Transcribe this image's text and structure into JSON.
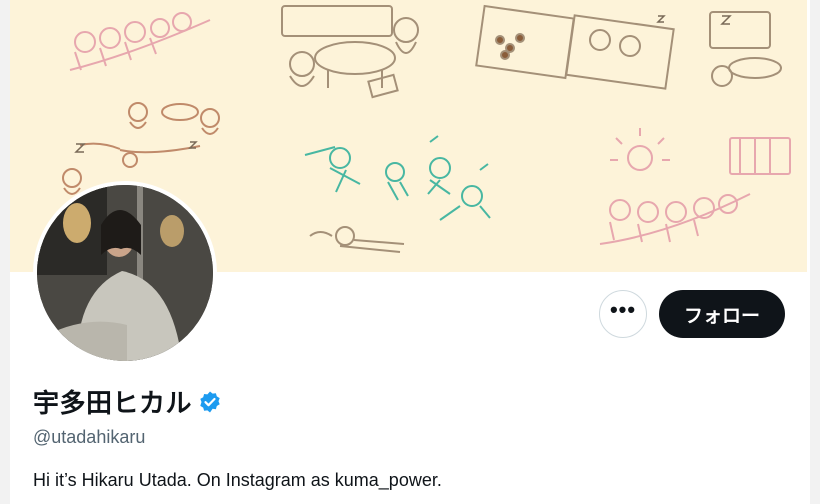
{
  "profile": {
    "display_name": "宇多田ヒカル",
    "handle": "@utadahikaru",
    "bio": "Hi it’s Hikaru Utada. On Instagram as kuma_power.",
    "verified": true
  },
  "actions": {
    "more_label": "•••",
    "follow_label": "フォロー"
  },
  "colors": {
    "banner_background": "#fdf3d9",
    "sketch_brown": "#b9a58b",
    "sketch_pink": "#e7a7ae",
    "sketch_teal": "#48b7a2",
    "follow_button": "#0f1419",
    "verified_badge": "#1d9bf0"
  },
  "icons": {
    "verified": "verified-badge-icon",
    "more": "more-dots-icon"
  }
}
